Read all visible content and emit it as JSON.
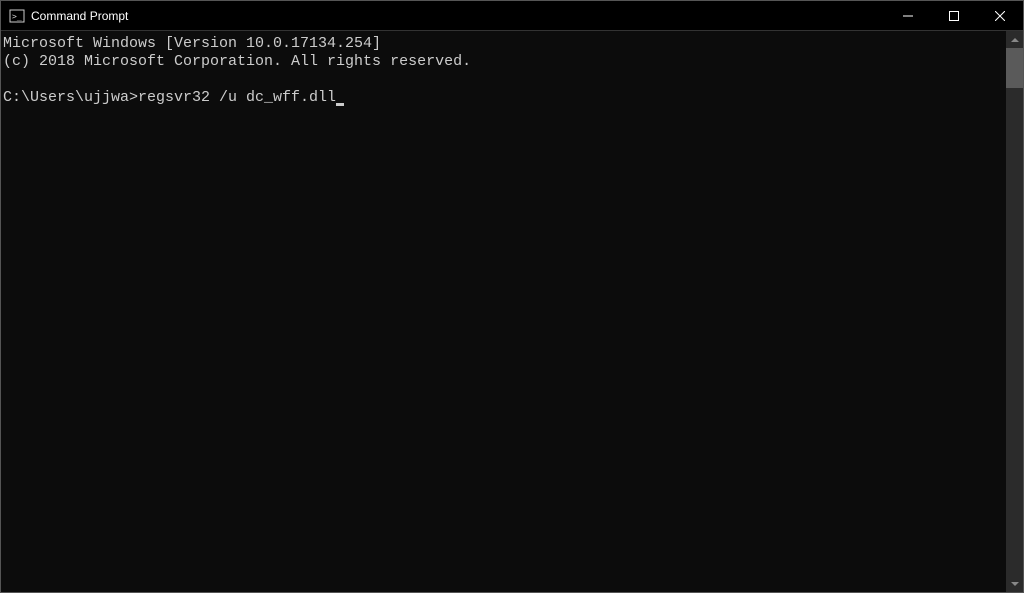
{
  "titlebar": {
    "title": "Command Prompt"
  },
  "terminal": {
    "line1": "Microsoft Windows [Version 10.0.17134.254]",
    "line2": "(c) 2018 Microsoft Corporation. All rights reserved.",
    "blank": "",
    "prompt": "C:\\Users\\ujjwa>",
    "command": "regsvr32 /u dc_wff.dll"
  }
}
